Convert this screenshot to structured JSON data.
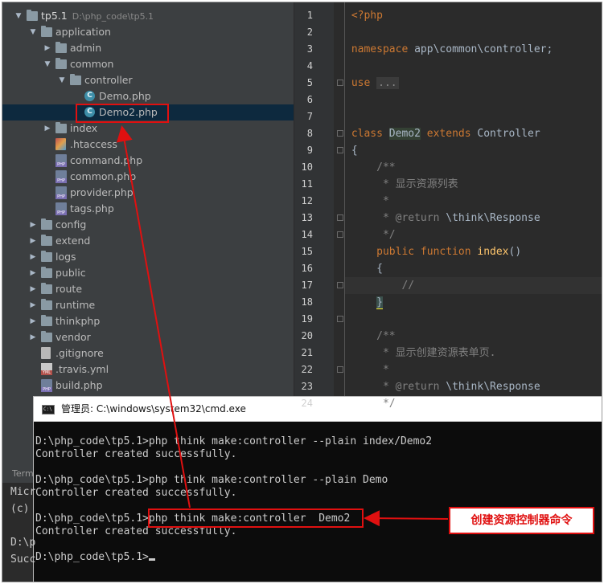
{
  "tree": {
    "items": [
      {
        "label": "tp5.1",
        "path": "D:\\php_code\\tp5.1",
        "icon": "folder-icon",
        "arrow": "▼"
      },
      {
        "label": "application",
        "icon": "folder-icon",
        "arrow": "▼"
      },
      {
        "label": "admin",
        "icon": "folder-icon",
        "arrow": "▶"
      },
      {
        "label": "common",
        "icon": "folder-icon",
        "arrow": "▼"
      },
      {
        "label": "controller",
        "icon": "folder-icon",
        "arrow": "▼"
      },
      {
        "label": "Demo.php",
        "icon": "php-class-icon"
      },
      {
        "label": "Demo2.php",
        "icon": "php-class-icon"
      },
      {
        "label": "index",
        "icon": "folder-icon",
        "arrow": "▶"
      },
      {
        "label": ".htaccess",
        "icon": "htaccess-file-icon"
      },
      {
        "label": "command.php",
        "icon": "php-file-icon"
      },
      {
        "label": "common.php",
        "icon": "php-file-icon"
      },
      {
        "label": "provider.php",
        "icon": "php-file-icon"
      },
      {
        "label": "tags.php",
        "icon": "php-file-icon"
      },
      {
        "label": "config",
        "icon": "folder-icon",
        "arrow": "▶"
      },
      {
        "label": "extend",
        "icon": "folder-icon",
        "arrow": "▶"
      },
      {
        "label": "logs",
        "icon": "folder-icon",
        "arrow": "▶"
      },
      {
        "label": "public",
        "icon": "folder-icon",
        "arrow": "▶"
      },
      {
        "label": "route",
        "icon": "folder-icon",
        "arrow": "▶"
      },
      {
        "label": "runtime",
        "icon": "folder-icon",
        "arrow": "▶"
      },
      {
        "label": "thinkphp",
        "icon": "folder-icon",
        "arrow": "▶"
      },
      {
        "label": "vendor",
        "icon": "folder-icon",
        "arrow": "▶"
      },
      {
        "label": ".gitignore",
        "icon": "text-file-icon"
      },
      {
        "label": ".travis.yml",
        "icon": "yml-file-icon"
      },
      {
        "label": "build.php",
        "icon": "php-file-icon"
      }
    ]
  },
  "editor": {
    "line_numbers": [
      "1",
      "2",
      "3",
      "4",
      "5",
      "6",
      "7",
      "8",
      "9",
      "10",
      "11",
      "12",
      "13",
      "14",
      "15",
      "16",
      "17",
      "18",
      "19",
      "20",
      "21",
      "22",
      "23",
      "24"
    ],
    "l1": "<?php",
    "l3_kw": "namespace",
    "l3_rest": " app\\common\\controller;",
    "l5_kw": "use",
    "l5_fold": "...",
    "l8_kw1": "class",
    "l8_name": "Demo2",
    "l8_kw2": "extends",
    "l8_parent": "Controller",
    "l9": "{",
    "l10": "/**",
    "l11": " * 显示资源列表",
    "l12": " *",
    "l13_tag": " * @return",
    "l13_type": " \\think\\Response",
    "l14": " */",
    "l15_kw": "public function",
    "l15_fn": "index",
    "l15_paren": "()",
    "l16": "{",
    "l17": "//",
    "l18": "}",
    "l20": "/**",
    "l21": " * 显示创建资源表单页.",
    "l22": " *",
    "l23_tag": " * @return",
    "l23_type": " \\think\\Response",
    "l24": " */"
  },
  "terminal_stub": {
    "tab_label": "Terminal",
    "lines": [
      "Micr",
      "(c)",
      "",
      "D:\\p",
      "Succ"
    ]
  },
  "cmd": {
    "title": "管理员: C:\\windows\\system32\\cmd.exe",
    "lines": [
      "D:\\php_code\\tp5.1>php think make:controller --plain index/Demo2",
      "Controller created successfully.",
      "",
      "D:\\php_code\\tp5.1>php think make:controller --plain Demo",
      "Controller created successfully.",
      "",
      "D:\\php_code\\tp5.1>php think make:controller  Demo2",
      "Controller created successfully.",
      "",
      "D:\\php_code\\tp5.1>"
    ]
  },
  "annotation": {
    "callout_text": "创建资源控制器命令",
    "color": "#e01010"
  },
  "colors": {
    "tree_bg": "#3c3f41",
    "editor_bg": "#2b2b2b",
    "keyword": "#cc7832",
    "function": "#ffc66d",
    "doc_comment": "#629755",
    "cmd_bg": "#0c0c0c"
  }
}
